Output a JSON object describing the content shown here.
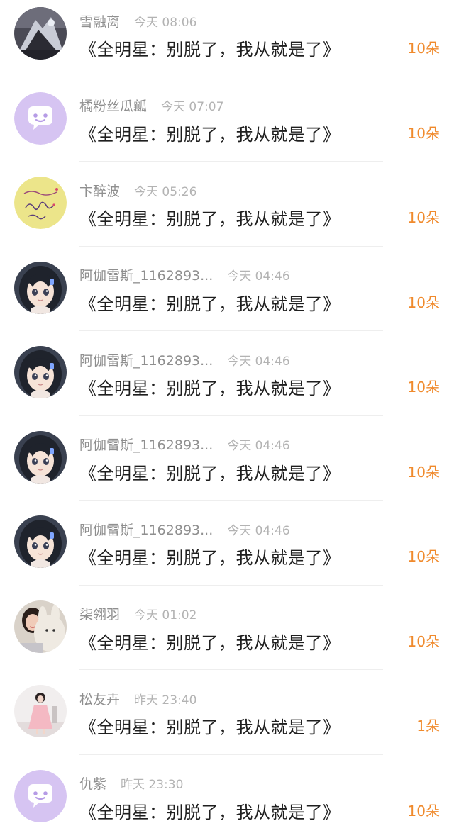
{
  "colors": {
    "flower_count": "#f08a2c",
    "username": "#8f8f8f",
    "timestamp": "#b3b3b3",
    "message": "#1f1f1f",
    "default_avatar": "#d4c1f0"
  },
  "comments": [
    {
      "username": "雪融离",
      "time": "今天 08:06",
      "message": "《全明星：别脱了，我从就是了》",
      "flowers": "10朵",
      "avatar": "photo-dark"
    },
    {
      "username": "橘粉丝瓜瓤",
      "time": "今天 07:07",
      "message": "《全明星：别脱了，我从就是了》",
      "flowers": "10朵",
      "avatar": "default-chat-bubble-icon"
    },
    {
      "username": "卞醉波",
      "time": "今天 05:26",
      "message": "《全明星：别脱了，我从就是了》",
      "flowers": "10朵",
      "avatar": "autograph-note"
    },
    {
      "username": "阿伽雷斯_1162893...",
      "time": "今天 04:46",
      "message": "《全明星：别脱了，我从就是了》",
      "flowers": "10朵",
      "avatar": "anime-girl"
    },
    {
      "username": "阿伽雷斯_1162893...",
      "time": "今天 04:46",
      "message": "《全明星：别脱了，我从就是了》",
      "flowers": "10朵",
      "avatar": "anime-girl"
    },
    {
      "username": "阿伽雷斯_1162893...",
      "time": "今天 04:46",
      "message": "《全明星：别脱了，我从就是了》",
      "flowers": "10朵",
      "avatar": "anime-girl"
    },
    {
      "username": "阿伽雷斯_1162893...",
      "time": "今天 04:46",
      "message": "《全明星：别脱了，我从就是了》",
      "flowers": "10朵",
      "avatar": "anime-girl"
    },
    {
      "username": "柒翎羽",
      "time": "今天 01:02",
      "message": "《全明星：别脱了，我从就是了》",
      "flowers": "10朵",
      "avatar": "girl-with-plush"
    },
    {
      "username": "松友卉",
      "time": "昨天 23:40",
      "message": "《全明星：别脱了，我从就是了》",
      "flowers": "1朵",
      "avatar": "girl-pink-dress"
    },
    {
      "username": "仇紫",
      "time": "昨天 23:30",
      "message": "《全明星：别脱了，我从就是了》",
      "flowers": "10朵",
      "avatar": "default-chat-bubble-icon"
    }
  ]
}
